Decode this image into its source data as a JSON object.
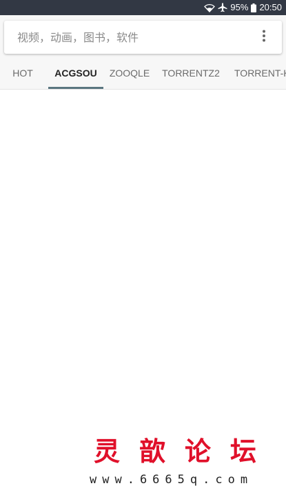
{
  "status_bar": {
    "battery": "95%",
    "time": "20:50",
    "icons": [
      "wifi-icon",
      "airplane-icon",
      "battery-icon"
    ]
  },
  "search": {
    "placeholder": "视频，动画，图书，软件",
    "value": "",
    "menu_icon": "more-vert-icon"
  },
  "tabs": [
    {
      "label": "HOT",
      "active": false
    },
    {
      "label": "ACGSOU",
      "active": true
    },
    {
      "label": "ZOOQLE",
      "active": false
    },
    {
      "label": "TORRENTZ2",
      "active": false
    },
    {
      "label": "TORRENT-KI",
      "active": false
    }
  ],
  "watermark": {
    "title": "灵歆论坛",
    "url": "www.6665q.com"
  },
  "colors": {
    "status_bar": "#323844",
    "header": "#f7f7f7",
    "tab_indicator": "#5a7680",
    "watermark_red": "#e0102a"
  }
}
